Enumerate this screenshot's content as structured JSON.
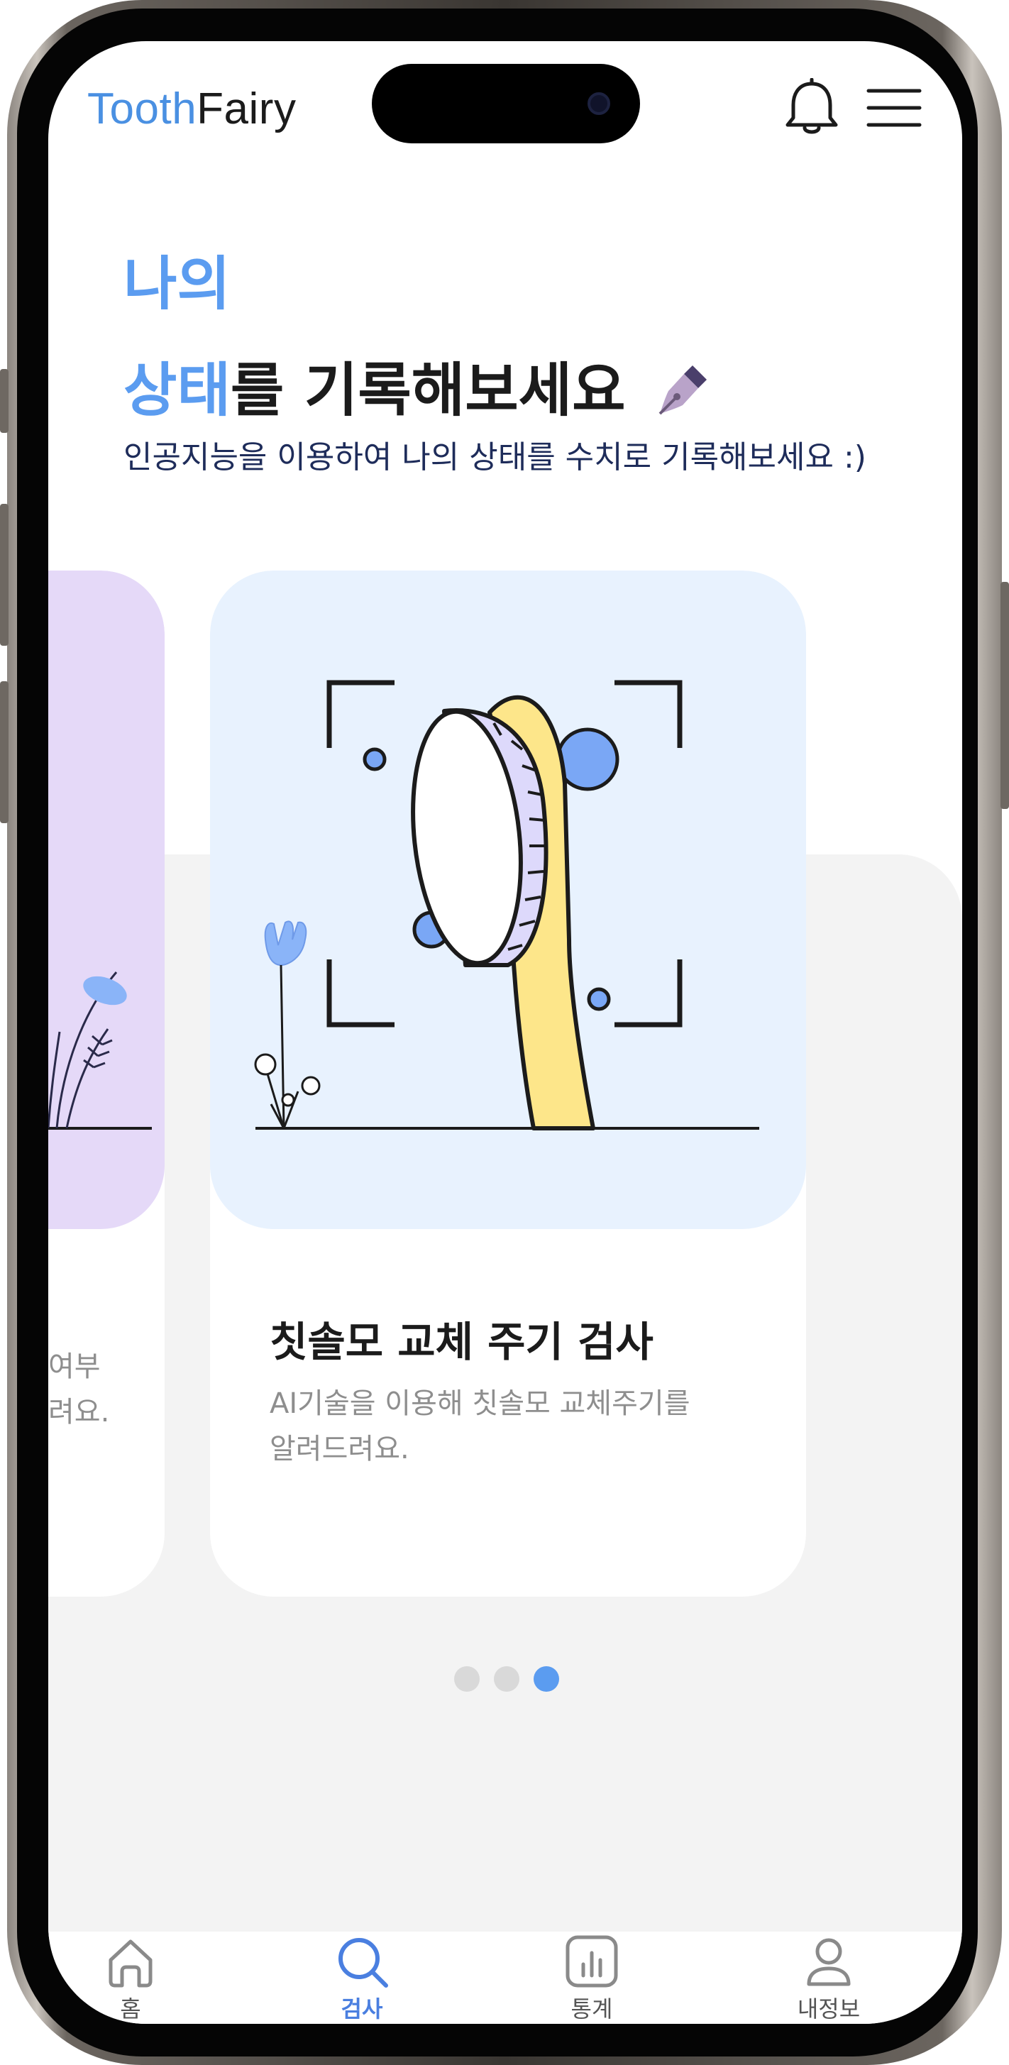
{
  "header": {
    "logo_part1": "Tooth",
    "logo_part2": "Fairy"
  },
  "hero": {
    "title_line1": "나의",
    "title_line2_highlight": "상태",
    "title_line2_rest": "를 기록해보세요",
    "subtitle": "인공지능을 이용하여 나의 상태를 수치로 기록해보세요 :)"
  },
  "carousel": {
    "prev_card": {
      "desc_line1": "여부",
      "desc_line2": "려요."
    },
    "active_card": {
      "title": "칫솔모 교체 주기 검사",
      "desc_line1": "AI기술을 이용해 칫솔모 교체주기를",
      "desc_line2": "알려드려요."
    },
    "page_count": 3,
    "active_page": 3
  },
  "nav": {
    "items": [
      {
        "label": "홈"
      },
      {
        "label": "검사"
      },
      {
        "label": "통계"
      },
      {
        "label": "내정보"
      }
    ],
    "active_index": 1
  },
  "colors": {
    "accent": "#5b9cf0",
    "card_blue": "#e8f2fe",
    "card_purple": "#e5d9f8",
    "brush_yellow": "#fde68a",
    "bristle_lavender": "#ddd9fb"
  }
}
